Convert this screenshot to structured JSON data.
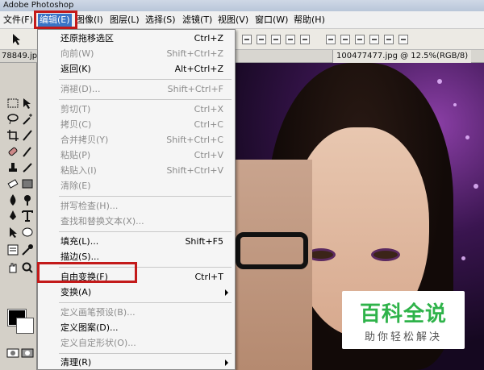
{
  "app": {
    "title": "Adobe Photoshop"
  },
  "menubar": {
    "items": [
      {
        "label": "文件(F)"
      },
      {
        "label": "编辑(E)"
      },
      {
        "label": "图像(I)"
      },
      {
        "label": "图层(L)"
      },
      {
        "label": "选择(S)"
      },
      {
        "label": "滤镜(T)"
      },
      {
        "label": "视图(V)"
      },
      {
        "label": "窗口(W)"
      },
      {
        "label": "帮助(H)"
      }
    ],
    "active": "编辑(E)"
  },
  "documents": {
    "left_tab": "78849.jp",
    "right_tab": "100477477.jpg @ 12.5%(RGB/8)"
  },
  "edit_menu": {
    "items": [
      {
        "label": "还原拖移选区",
        "shortcut": "Ctrl+Z",
        "disabled": false
      },
      {
        "label": "向前(W)",
        "shortcut": "Shift+Ctrl+Z",
        "disabled": true
      },
      {
        "label": "返回(K)",
        "shortcut": "Alt+Ctrl+Z",
        "disabled": false
      },
      {
        "label": "消褪(D)...",
        "shortcut": "Shift+Ctrl+F",
        "disabled": true
      },
      {
        "label": "剪切(T)",
        "shortcut": "Ctrl+X",
        "disabled": true
      },
      {
        "label": "拷贝(C)",
        "shortcut": "Ctrl+C",
        "disabled": true
      },
      {
        "label": "合并拷贝(Y)",
        "shortcut": "Shift+Ctrl+C",
        "disabled": true
      },
      {
        "label": "粘贴(P)",
        "shortcut": "Ctrl+V",
        "disabled": true
      },
      {
        "label": "粘贴入(I)",
        "shortcut": "Shift+Ctrl+V",
        "disabled": true
      },
      {
        "label": "清除(E)",
        "shortcut": "",
        "disabled": true
      },
      {
        "label": "拼写检查(H)...",
        "shortcut": "",
        "disabled": true
      },
      {
        "label": "查找和替换文本(X)...",
        "shortcut": "",
        "disabled": true
      },
      {
        "label": "填充(L)...",
        "shortcut": "Shift+F5",
        "disabled": false
      },
      {
        "label": "描边(S)...",
        "shortcut": "",
        "disabled": false
      },
      {
        "label": "自由变换(F)",
        "shortcut": "Ctrl+T",
        "disabled": false
      },
      {
        "label": "变换(A)",
        "shortcut": "",
        "disabled": false,
        "submenu": true
      },
      {
        "label": "定义画笔预设(B)...",
        "shortcut": "",
        "disabled": true
      },
      {
        "label": "定义图案(D)...",
        "shortcut": "",
        "disabled": false
      },
      {
        "label": "定义自定形状(O)...",
        "shortcut": "",
        "disabled": true
      },
      {
        "label": "清理(R)",
        "shortcut": "",
        "disabled": false,
        "submenu": true
      }
    ]
  },
  "watermark": {
    "title": "百科全说",
    "subtitle": "助你轻松解决"
  },
  "colors": {
    "highlight_box": "#c31a1a",
    "menu_active": "#3a74c6",
    "watermark_green": "#2fb34a"
  }
}
